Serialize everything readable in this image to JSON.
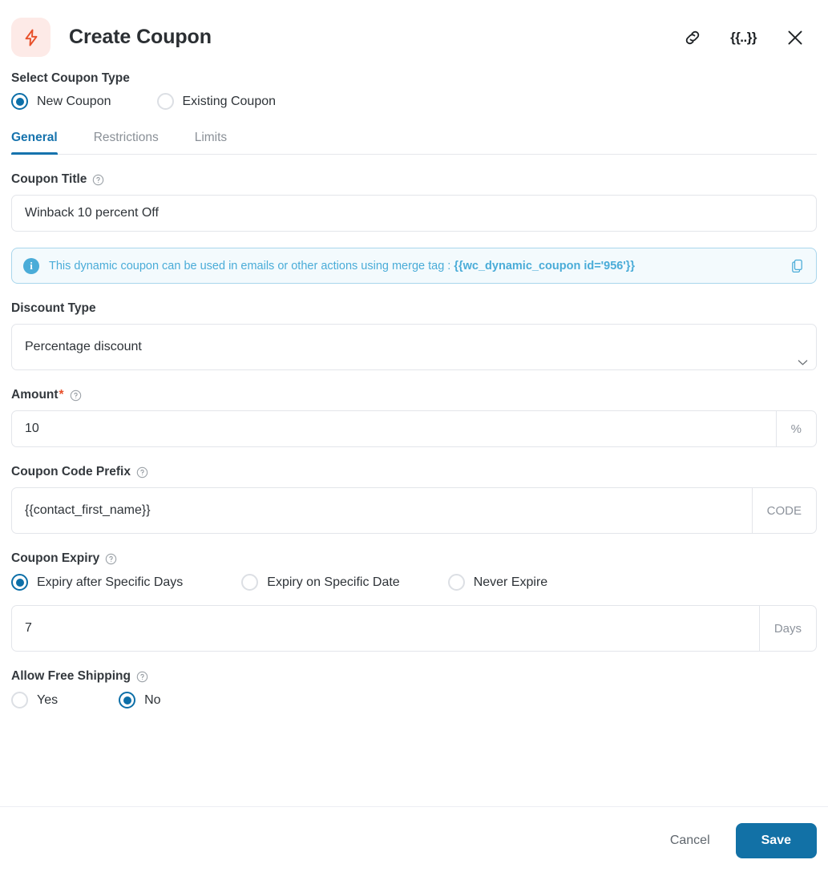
{
  "header": {
    "title": "Create Coupon",
    "brand_icon": "lightning-bolt-icon",
    "brand_icon_bg": "#fdeae7",
    "brand_icon_color": "#e8502a",
    "actions": [
      {
        "name": "link-icon",
        "label": ""
      },
      {
        "name": "merge-tag-icon",
        "label": "{{..}}"
      },
      {
        "name": "close-icon",
        "label": ""
      }
    ]
  },
  "coupon_type": {
    "label": "Select Coupon Type",
    "options": [
      {
        "label": "New Coupon",
        "selected": true
      },
      {
        "label": "Existing Coupon",
        "selected": false
      }
    ]
  },
  "tabs": [
    {
      "label": "General",
      "active": true
    },
    {
      "label": "Restrictions",
      "active": false
    },
    {
      "label": "Limits",
      "active": false
    }
  ],
  "fields": {
    "coupon_title": {
      "label": "Coupon Title",
      "value": "Winback 10 percent Off",
      "placeholder": "Coupon Title",
      "help": "?"
    },
    "discount_type": {
      "label": "Discount Type",
      "value": "Percentage discount"
    },
    "amount": {
      "label": "Amount",
      "required_marker": "*",
      "value": "10",
      "placeholder": "Amount",
      "addon": "%",
      "help": "?"
    },
    "coupon_code_prefix": {
      "label": "Coupon Code Prefix",
      "value": "{{contact_first_name}}",
      "placeholder": "Coupon Code Prefix",
      "addon": "CODE",
      "help": "?"
    },
    "coupon_expiry": {
      "label": "Coupon Expiry",
      "help": "?",
      "options": [
        {
          "label": "Expiry after Specific Days",
          "selected": true
        },
        {
          "label": "Expiry on Specific Date",
          "selected": false
        },
        {
          "label": "Never Expire",
          "selected": false
        }
      ],
      "days_value": "7",
      "days_placeholder": "Days",
      "days_addon": "Days"
    },
    "allow_free_shipping": {
      "label": "Allow Free Shipping",
      "help": "?",
      "options": [
        {
          "label": "Yes",
          "selected": false
        },
        {
          "label": "No",
          "selected": true
        }
      ]
    }
  },
  "info_banner": {
    "icon": "info-icon",
    "text": "This dynamic coupon can be used in emails or other actions using merge tag : ",
    "merge_tag": "{{wc_dynamic_coupon id='956'}}",
    "copy_icon": "copy-icon",
    "accent_color": "#4aacd8"
  },
  "footer": {
    "cancel_label": "Cancel",
    "save_label": "Save",
    "save_color": "#1271a6"
  }
}
